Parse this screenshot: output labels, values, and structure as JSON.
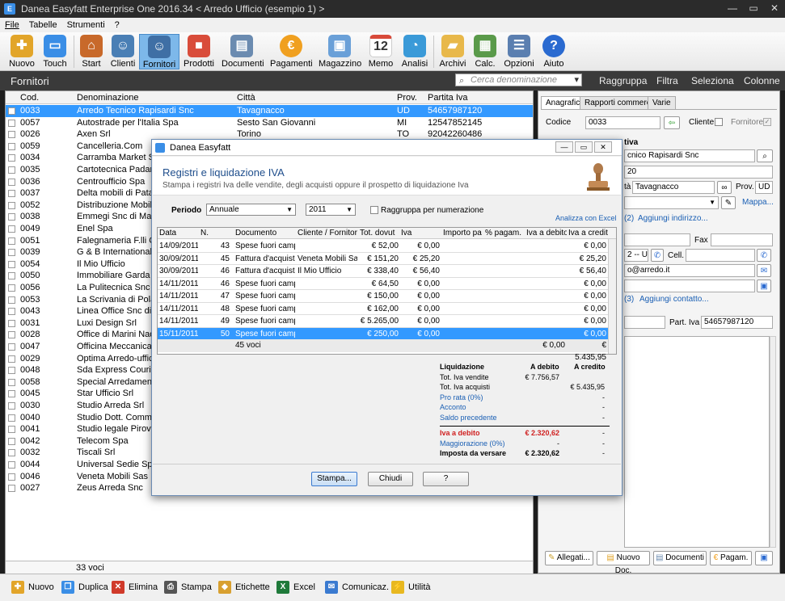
{
  "window": {
    "title": "Danea Easyfatt Enterprise One  2016.34   < Arredo Ufficio (esempio 1) >"
  },
  "menu": [
    "File",
    "Tabelle",
    "Strumenti",
    "?"
  ],
  "ribbon": {
    "items": [
      {
        "label": "Nuovo",
        "icon": "new-doc-icon",
        "color": "#e2a52a"
      },
      {
        "label": "Touch",
        "icon": "touch-monitor-icon",
        "color": "#3a8ee6"
      },
      {
        "label": "Start",
        "icon": "home-icon",
        "color": "#c8692a"
      },
      {
        "label": "Clienti",
        "icon": "client-person-icon",
        "color": "#4a7fb5"
      },
      {
        "label": "Fornitori",
        "icon": "supplier-person-icon",
        "color": "#3f6fa5"
      },
      {
        "label": "Prodotti",
        "icon": "products-boxes-icon",
        "color": "#d94c3a"
      },
      {
        "label": "Documenti",
        "icon": "documents-icon",
        "color": "#6b8bb0"
      },
      {
        "label": "Pagamenti",
        "icon": "euro-icon",
        "color": "#f0a020"
      },
      {
        "label": "Magazzino",
        "icon": "warehouse-trolley-icon",
        "color": "#6aa0d8"
      },
      {
        "label": "Memo",
        "icon": "calendar-icon",
        "color": "#d84a3a"
      },
      {
        "label": "Analisi",
        "icon": "analysis-chart-icon",
        "color": "#3a9ad8"
      },
      {
        "label": "Archivi",
        "icon": "archive-folder-icon",
        "color": "#e8b84a"
      },
      {
        "label": "Calc.",
        "icon": "calculator-icon",
        "color": "#5a9a4a"
      },
      {
        "label": "Opzioni",
        "icon": "options-list-icon",
        "color": "#5b7fb0"
      },
      {
        "label": "Aiuto",
        "icon": "help-question-icon",
        "color": "#2a6ad0"
      }
    ],
    "memo_day": "12"
  },
  "section": {
    "title": "Fornitori",
    "search_placeholder": "Cerca denominazione",
    "actions": [
      "Raggruppa",
      "Filtra",
      "Seleziona",
      "Colonne"
    ]
  },
  "list": {
    "columns": [
      "Cod.",
      "Denominazione",
      "Città",
      "Prov.",
      "Partita Iva"
    ],
    "rows": [
      [
        "0033",
        "Arredo Tecnico Rapisardi Snc",
        "Tavagnacco",
        "UD",
        "54657987120"
      ],
      [
        "0057",
        "Autostrade per l'Italia Spa",
        "Sesto San Giovanni",
        "MI",
        "12547852145"
      ],
      [
        "0026",
        "Axen Srl",
        "Torino",
        "TO",
        "92042260486"
      ],
      [
        "0059",
        "Cancelleria.Com",
        "",
        "",
        ""
      ],
      [
        "0034",
        "Carramba Market S.I.",
        "",
        "",
        ""
      ],
      [
        "0035",
        "Cartotecnica Padana Sa",
        "",
        "",
        ""
      ],
      [
        "0036",
        "Centroufficio Spa",
        "",
        "",
        ""
      ],
      [
        "0037",
        "Delta mobili di Patagna",
        "",
        "",
        ""
      ],
      [
        "0052",
        "Distribuzione Mobili Pern",
        "",
        "",
        ""
      ],
      [
        "0038",
        "Emmegi Snc di Malvolt",
        "",
        "",
        ""
      ],
      [
        "0049",
        "Enel Spa",
        "",
        "",
        ""
      ],
      [
        "0051",
        "Falegnameria F.lli Carli",
        "",
        "",
        ""
      ],
      [
        "0039",
        "G & B International Gr",
        "",
        "",
        ""
      ],
      [
        "0054",
        "Il Mio Ufficio",
        "",
        "",
        ""
      ],
      [
        "0050",
        "Immobiliare Garda Srl",
        "",
        "",
        ""
      ],
      [
        "0056",
        "La Pulitecnica Snc",
        "",
        "",
        ""
      ],
      [
        "0053",
        "La Scrivania di Polaris A",
        "",
        "",
        ""
      ],
      [
        "0043",
        "Linea Office Snc di Vo",
        "",
        "",
        ""
      ],
      [
        "0031",
        "Luxi Design Srl",
        "",
        "",
        ""
      ],
      [
        "0028",
        "Office di Marini Nadia",
        "",
        "",
        ""
      ],
      [
        "0047",
        "Officina Meccanica Rico",
        "",
        "",
        ""
      ],
      [
        "0029",
        "Optima Arredo-ufficio",
        "",
        "",
        ""
      ],
      [
        "0048",
        "Sda Express Courier",
        "",
        "",
        ""
      ],
      [
        "0058",
        "Special Arredamento R",
        "",
        "",
        ""
      ],
      [
        "0045",
        "Star Ufficio Srl",
        "",
        "",
        ""
      ],
      [
        "0030",
        "Studio Arreda Srl",
        "",
        "",
        ""
      ],
      [
        "0040",
        "Studio Dott. Comm. Pi",
        "",
        "",
        ""
      ],
      [
        "0041",
        "Studio legale Pirovano",
        "",
        "",
        ""
      ],
      [
        "0042",
        "Telecom Spa",
        "",
        "",
        ""
      ],
      [
        "0032",
        "Tiscali Srl",
        "",
        "",
        ""
      ],
      [
        "0044",
        "Universal Sedie Spa",
        "",
        "",
        ""
      ],
      [
        "0046",
        "Veneta Mobili Sas",
        "",
        "",
        ""
      ],
      [
        "0027",
        "Zeus Arreda Snc",
        "",
        "",
        ""
      ]
    ],
    "footer": "33 voci"
  },
  "detail": {
    "tabs": [
      "Anagrafica",
      "Rapporti commerciali",
      "Varie"
    ],
    "codice_label": "Codice",
    "codice": "0033",
    "cliente_label": "Cliente",
    "fornitore_label": "Fornitore",
    "frag_tiva": "tiva",
    "frag_name": "cnico Rapisardi Snc",
    "frag_cap": "20",
    "city_frag": "tà",
    "city": "Tavagnacco",
    "prov_label": "Prov.",
    "prov": "UD",
    "mappa": "Mappa...",
    "frag_addr": "(2)",
    "aggiungi_indirizzo": "Aggiungi indirizzo...",
    "fax_label": "Fax",
    "frag_uffi": "2 -- Uffi",
    "cell_label": "Cell.",
    "frag_email": "o@arredo.it",
    "frag_contact": "(3)",
    "aggiungi_contatto": "Aggiungi contatto...",
    "piva_label": "Part. Iva",
    "piva": "54657987120",
    "buttons": [
      "Allegati...",
      "Nuovo Doc.",
      "Documenti",
      "Pagam."
    ]
  },
  "bottom": {
    "items": [
      {
        "label": "Nuovo",
        "icon": "new-icon",
        "color": "#e2a52a"
      },
      {
        "label": "Duplica",
        "icon": "duplicate-icon",
        "color": "#3a8ee6"
      },
      {
        "label": "Elimina",
        "icon": "delete-icon",
        "color": "#d03a2a"
      },
      {
        "label": "Stampa",
        "icon": "print-icon",
        "color": "#555555"
      },
      {
        "label": "Etichette",
        "icon": "labels-icon",
        "color": "#d8a030"
      },
      {
        "label": "Excel",
        "icon": "excel-icon",
        "color": "#1f7a3a"
      },
      {
        "label": "Comunicaz.",
        "icon": "mail-icon",
        "color": "#3a7ad0"
      },
      {
        "label": "Utilità",
        "icon": "utility-bolt-icon",
        "color": "#e8b820"
      }
    ]
  },
  "dialog": {
    "title": "Danea Easyfatt",
    "heading": "Registri e liquidazione IVA",
    "subheading": "Stampa i registri Iva delle vendite, degli acquisti oppure il prospetto di liquidazione Iva",
    "periodo_label": "Periodo",
    "periodo": "Annuale",
    "year": "2011",
    "raggruppa": "Raggruppa per numerazione",
    "analizza": "Analizza con Excel",
    "columns": [
      "Data",
      "N.",
      "Documento",
      "Cliente / Fornitor",
      "Tot. dovut",
      "Iva",
      "Importo pa",
      "% pagam.",
      "Iva a debito",
      "Iva a credit"
    ],
    "rows": [
      [
        "14/09/2011",
        "43",
        "Spese fuori camp",
        "",
        "€ 52,00",
        "€ 0,00",
        "",
        "",
        "",
        "€ 0,00"
      ],
      [
        "30/09/2011",
        "45",
        "Fattura d'acquisto",
        "Veneta Mobili Sas",
        "€ 151,20",
        "€ 25,20",
        "",
        "",
        "",
        "€ 25,20"
      ],
      [
        "30/09/2011",
        "46",
        "Fattura d'acquisto",
        "Il Mio Ufficio",
        "€ 338,40",
        "€ 56,40",
        "",
        "",
        "",
        "€ 56,40"
      ],
      [
        "14/11/2011",
        "46",
        "Spese fuori camp",
        "",
        "€ 64,50",
        "€ 0,00",
        "",
        "",
        "",
        "€ 0,00"
      ],
      [
        "14/11/2011",
        "47",
        "Spese fuori camp",
        "",
        "€ 150,00",
        "€ 0,00",
        "",
        "",
        "",
        "€ 0,00"
      ],
      [
        "14/11/2011",
        "48",
        "Spese fuori camp",
        "",
        "€ 162,00",
        "€ 0,00",
        "",
        "",
        "",
        "€ 0,00"
      ],
      [
        "14/11/2011",
        "49",
        "Spese fuori camp",
        "",
        "€ 5.265,00",
        "€ 0,00",
        "",
        "",
        "",
        "€ 0,00"
      ],
      [
        "15/11/2011",
        "50",
        "Spese fuori camp",
        "",
        "€ 250,00",
        "€ 0,00",
        "",
        "",
        "",
        "€ 0,00"
      ]
    ],
    "selected_row": 7,
    "summary": {
      "count": "45 voci",
      "debito": "€ 0,00",
      "credito": "€ 5.435,95"
    },
    "liquidazione": {
      "header": [
        "Liquidazione",
        "A debito",
        "A credito"
      ],
      "rows": [
        {
          "label": "Tot. Iva vendite",
          "debito": "€ 7.756,57",
          "credito": "",
          "link": false
        },
        {
          "label": "Tot. Iva acquisti",
          "debito": "",
          "credito": "€ 5.435,95",
          "link": false
        },
        {
          "label": "Pro rata (0%)",
          "debito": "",
          "credito": "-",
          "link": true
        },
        {
          "label": "Acconto",
          "debito": "",
          "credito": "-",
          "link": true
        },
        {
          "label": "Saldo precedente",
          "debito": "",
          "credito": "-",
          "link": true
        }
      ],
      "iva_debito_label": "Iva a debito",
      "iva_debito": "€ 2.320,62",
      "iva_debito_dash": "-",
      "maggiorazione_label": "Maggiorazione (0%)",
      "maggiorazione": "-",
      "maggiorazione_dash": "-",
      "imposta_label": "Imposta da versare",
      "imposta": "€ 2.320,62",
      "imposta_dash": "-"
    },
    "buttons": [
      "Stampa...",
      "Chiudi",
      "?"
    ]
  },
  "colors": {
    "selection": "#3399ff",
    "accent": "#1f4e8c",
    "alert": "#d02020"
  }
}
